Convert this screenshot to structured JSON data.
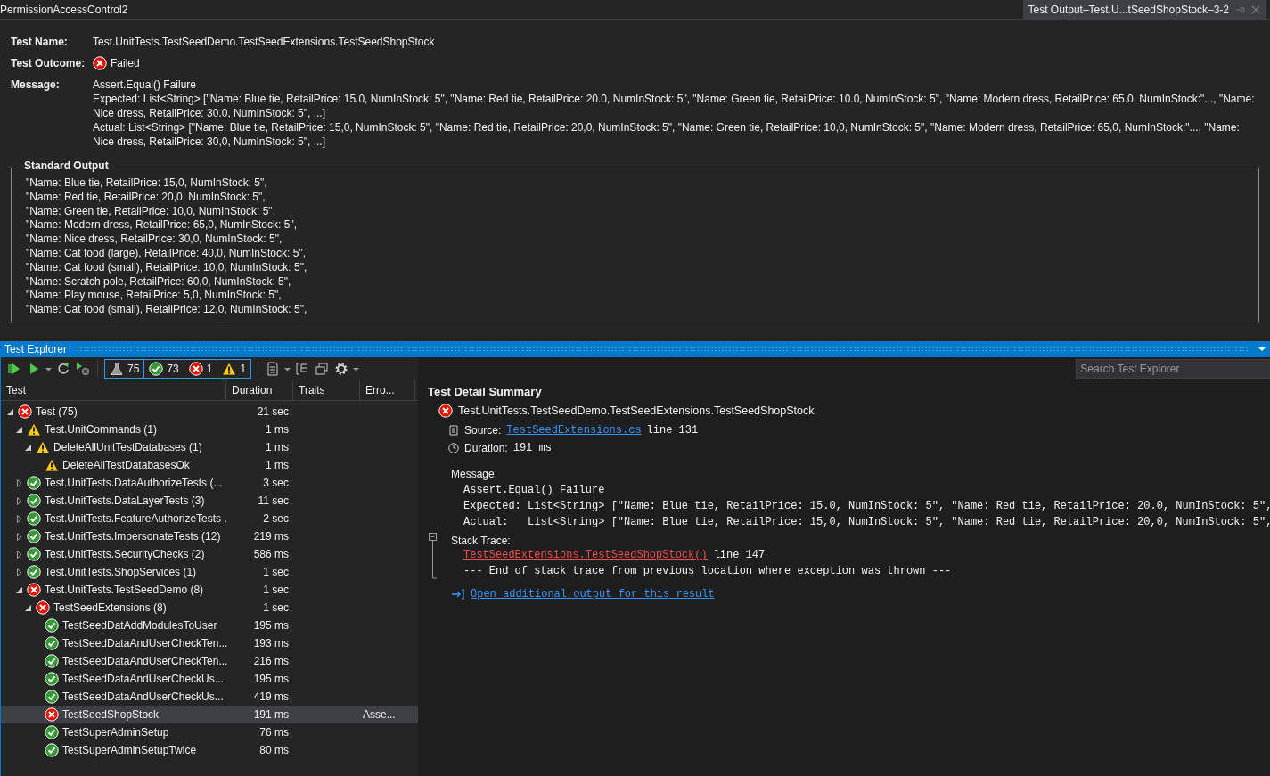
{
  "window": {
    "title": "PermissionAccessControl2"
  },
  "doc_tab": {
    "label": "Test Output–Test.U...tSeedShopStock–3-2",
    "selected": true
  },
  "output": {
    "test_name_label": "Test Name:",
    "test_name": "Test.UnitTests.TestSeedDemo.TestSeedExtensions.TestSeedShopStock",
    "outcome_label": "Test Outcome:",
    "outcome": {
      "kind": "failed",
      "text": "Failed"
    },
    "message_label": "Message:",
    "message_lines": [
      "Assert.Equal() Failure",
      "Expected: List<String> [\"Name: Blue tie, RetailPrice: 15.0, NumInStock: 5\", \"Name: Red tie, RetailPrice: 20.0, NumInStock: 5\", \"Name: Green tie, RetailPrice: 10.0, NumInStock: 5\", \"Name: Modern dress, RetailPrice: 65.0, NumInStock:\"..., \"Name: Nice dress, RetailPrice: 30.0, NumInStock: 5\", ...]",
      "Actual:   List<String> [\"Name: Blue tie, RetailPrice: 15,0, NumInStock: 5\", \"Name: Red tie, RetailPrice: 20,0, NumInStock: 5\", \"Name: Green tie, RetailPrice: 10,0, NumInStock: 5\", \"Name: Modern dress, RetailPrice: 65,0, NumInStock:\"..., \"Name: Nice dress, RetailPrice: 30,0, NumInStock: 5\", ...]"
    ],
    "standard_output_title": "Standard Output",
    "standard_output_lines": [
      "\"Name: Blue tie, RetailPrice: 15,0, NumInStock: 5\",",
      "\"Name: Red tie, RetailPrice: 20,0, NumInStock: 5\",",
      "\"Name: Green tie, RetailPrice: 10,0, NumInStock: 5\",",
      "\"Name: Modern dress, RetailPrice: 65,0, NumInStock: 5\",",
      "\"Name: Nice dress, RetailPrice: 30,0, NumInStock: 5\",",
      "\"Name: Cat food (large), RetailPrice: 40,0, NumInStock: 5\",",
      "\"Name: Cat food (small), RetailPrice: 10,0, NumInStock: 5\",",
      "\"Name: Scratch pole, RetailPrice: 60,0, NumInStock: 5\",",
      "\"Name: Play mouse, RetailPrice: 5,0, NumInStock: 5\",",
      "\"Name: Cat food (small), RetailPrice: 12,0, NumInStock: 5\","
    ]
  },
  "explorer": {
    "title": "Test Explorer",
    "counters": [
      {
        "kind": "total",
        "count": "75"
      },
      {
        "kind": "passed",
        "count": "73"
      },
      {
        "kind": "failed",
        "count": "1"
      },
      {
        "kind": "warning",
        "count": "1"
      }
    ],
    "search": {
      "placeholder": "Search Test Explorer"
    },
    "columns": [
      "Test",
      "Duration",
      "Traits",
      "Erro..."
    ],
    "tree": [
      {
        "name": "Test (75)",
        "kind": "failed",
        "duration": "21 sec",
        "expanded": true,
        "selected": false,
        "children": [
          {
            "name": "Test.UnitCommands (1)",
            "kind": "warning",
            "duration": "1 ms",
            "expanded": true,
            "selected": false,
            "children": [
              {
                "name": "DeleteAllUnitTestDatabases (1)",
                "kind": "warning",
                "duration": "1 ms",
                "expanded": true,
                "selected": false,
                "children": [
                  {
                    "name": "DeleteAllTestDatabasesOk",
                    "kind": "warning",
                    "duration": "1 ms",
                    "selected": false
                  }
                ]
              }
            ]
          },
          {
            "name": "Test.UnitTests.DataAuthorizeTests (...",
            "kind": "passed",
            "duration": "3 sec",
            "expanded": false,
            "selected": false
          },
          {
            "name": "Test.UnitTests.DataLayerTests (3)",
            "kind": "passed",
            "duration": "11 sec",
            "expanded": false,
            "selected": false
          },
          {
            "name": "Test.UnitTests.FeatureAuthorizeTests .",
            "kind": "passed",
            "duration": "2 sec",
            "expanded": false,
            "selected": false
          },
          {
            "name": "Test.UnitTests.ImpersonateTests (12)",
            "kind": "passed",
            "duration": "219 ms",
            "expanded": false,
            "selected": false
          },
          {
            "name": "Test.UnitTests.SecurityChecks (2)",
            "kind": "passed",
            "duration": "586 ms",
            "expanded": false,
            "selected": false
          },
          {
            "name": "Test.UnitTests.ShopServices (1)",
            "kind": "passed",
            "duration": "1 sec",
            "expanded": false,
            "selected": false
          },
          {
            "name": "Test.UnitTests.TestSeedDemo (8)",
            "kind": "failed",
            "duration": "1 sec",
            "expanded": true,
            "selected": false,
            "children": [
              {
                "name": "TestSeedExtensions (8)",
                "kind": "failed",
                "duration": "1 sec",
                "expanded": true,
                "selected": false,
                "children": [
                  {
                    "name": "TestSeedDatAddModulesToUser",
                    "kind": "passed",
                    "duration": "195 ms",
                    "selected": false
                  },
                  {
                    "name": "TestSeedDataAndUserCheckTen...",
                    "kind": "passed",
                    "duration": "193 ms",
                    "selected": false
                  },
                  {
                    "name": "TestSeedDataAndUserCheckTen...",
                    "kind": "passed",
                    "duration": "216 ms",
                    "selected": false
                  },
                  {
                    "name": "TestSeedDataAndUserCheckUs...",
                    "kind": "passed",
                    "duration": "195 ms",
                    "selected": false
                  },
                  {
                    "name": "TestSeedDataAndUserCheckUs...",
                    "kind": "passed",
                    "duration": "419 ms",
                    "selected": false
                  },
                  {
                    "name": "TestSeedShopStock",
                    "kind": "failed",
                    "duration": "191 ms",
                    "error": "Asse...",
                    "selected": true
                  },
                  {
                    "name": "TestSuperAdminSetup",
                    "kind": "passed",
                    "duration": "76 ms",
                    "selected": false
                  },
                  {
                    "name": "TestSuperAdminSetupTwice",
                    "kind": "passed",
                    "duration": "80 ms",
                    "selected": false
                  }
                ]
              }
            ]
          }
        ]
      }
    ]
  },
  "detail": {
    "title": "Test Detail Summary",
    "test": {
      "kind": "failed",
      "name": "Test.UnitTests.TestSeedDemo.TestSeedExtensions.TestSeedShopStock"
    },
    "source_label": "Source:",
    "source_link": "TestSeedExtensions.cs",
    "source_line": "line 131",
    "duration_label": "Duration:",
    "duration": "191 ms",
    "message_label": "Message:",
    "message_lines": [
      "Assert.Equal() Failure",
      "Expected: List<String> [\"Name: Blue tie, RetailPrice: 15.0, NumInStock: 5\", \"Name: Red tie, RetailPrice: 20.0, NumInStock: 5\",",
      "Actual:   List<String> [\"Name: Blue tie, RetailPrice: 15,0, NumInStock: 5\", \"Name: Red tie, RetailPrice: 20,0, NumInStock: 5\","
    ],
    "stack_label": "Stack Trace:",
    "stack_expanded": true,
    "stack_link": "TestSeedExtensions.TestSeedShopStock()",
    "stack_line": "line 147",
    "stack_note": "--- End of stack trace from previous location where exception was thrown ---",
    "output_link": "Open additional output for this result"
  }
}
